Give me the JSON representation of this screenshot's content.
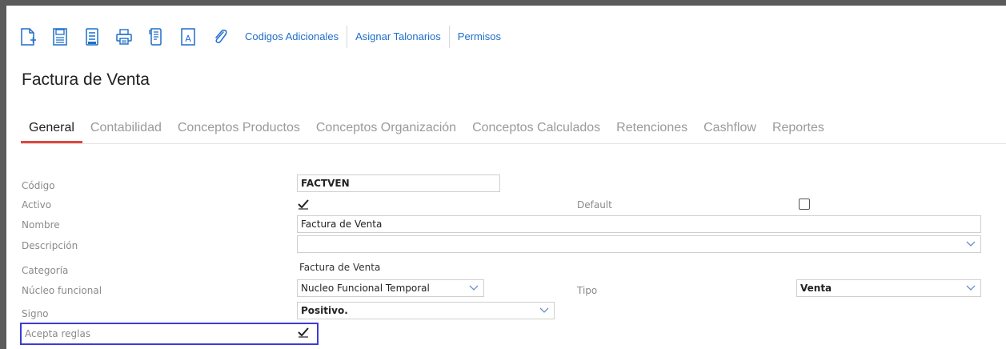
{
  "toolbar": {
    "icons": [
      "new-document-icon",
      "save-icon",
      "document-icon",
      "print-icon",
      "receipt-icon",
      "text-document-icon",
      "attachment-icon"
    ],
    "links": [
      "Codigos Adicionales",
      "Asignar Talonarios",
      "Permisos"
    ]
  },
  "page": {
    "title": "Factura de Venta"
  },
  "tabs": [
    "General",
    "Contabilidad",
    "Conceptos Productos",
    "Conceptos Organización",
    "Conceptos Calculados",
    "Retenciones",
    "Cashflow",
    "Reportes"
  ],
  "active_tab": "General",
  "form": {
    "codigo": {
      "label": "Código",
      "value": "FACTVEN"
    },
    "activo": {
      "label": "Activo",
      "checked": true
    },
    "default": {
      "label": "Default",
      "checked": false
    },
    "nombre": {
      "label": "Nombre",
      "value": "Factura de Venta"
    },
    "descripcion": {
      "label": "Descripción",
      "value": ""
    },
    "categoria": {
      "label": "Categoría",
      "value": "Factura de Venta"
    },
    "nucleo": {
      "label": "Núcleo funcional",
      "value": "Nucleo Funcional Temporal"
    },
    "tipo": {
      "label": "Tipo",
      "value": "Venta"
    },
    "signo": {
      "label": "Signo",
      "value": "Positivo."
    },
    "acepta_reglas": {
      "label": "Acepta reglas",
      "checked": true
    }
  },
  "colors": {
    "link": "#1e6ec8",
    "active_tab_underline": "#e0473d",
    "highlight_border": "#3b3bd6",
    "frame": "#5b5b5b"
  }
}
